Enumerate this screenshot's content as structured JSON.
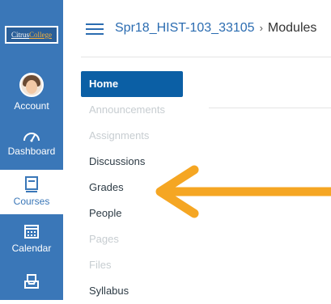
{
  "global_nav": {
    "logo_text_1": "Citrus",
    "logo_text_2": "College",
    "items": [
      {
        "label": "Account"
      },
      {
        "label": "Dashboard"
      },
      {
        "label": "Courses"
      },
      {
        "label": "Calendar"
      }
    ]
  },
  "header": {
    "course_link": "Spr18_HIST-103_33105",
    "separator": "›",
    "current_page": "Modules"
  },
  "course_nav": {
    "items": [
      {
        "label": "Home",
        "state": "active"
      },
      {
        "label": "Announcements",
        "state": "disabled"
      },
      {
        "label": "Assignments",
        "state": "disabled"
      },
      {
        "label": "Discussions",
        "state": "enabled"
      },
      {
        "label": "Grades",
        "state": "enabled"
      },
      {
        "label": "People",
        "state": "enabled"
      },
      {
        "label": "Pages",
        "state": "disabled"
      },
      {
        "label": "Files",
        "state": "disabled"
      },
      {
        "label": "Syllabus",
        "state": "enabled"
      }
    ]
  },
  "colors": {
    "global_nav_bg": "#3a77b8",
    "active_item": "#0b5fa5",
    "link": "#2b6cb1",
    "arrow": "#f5a623"
  },
  "annotation": {
    "icon": "orange-arrow-pointing-left"
  }
}
